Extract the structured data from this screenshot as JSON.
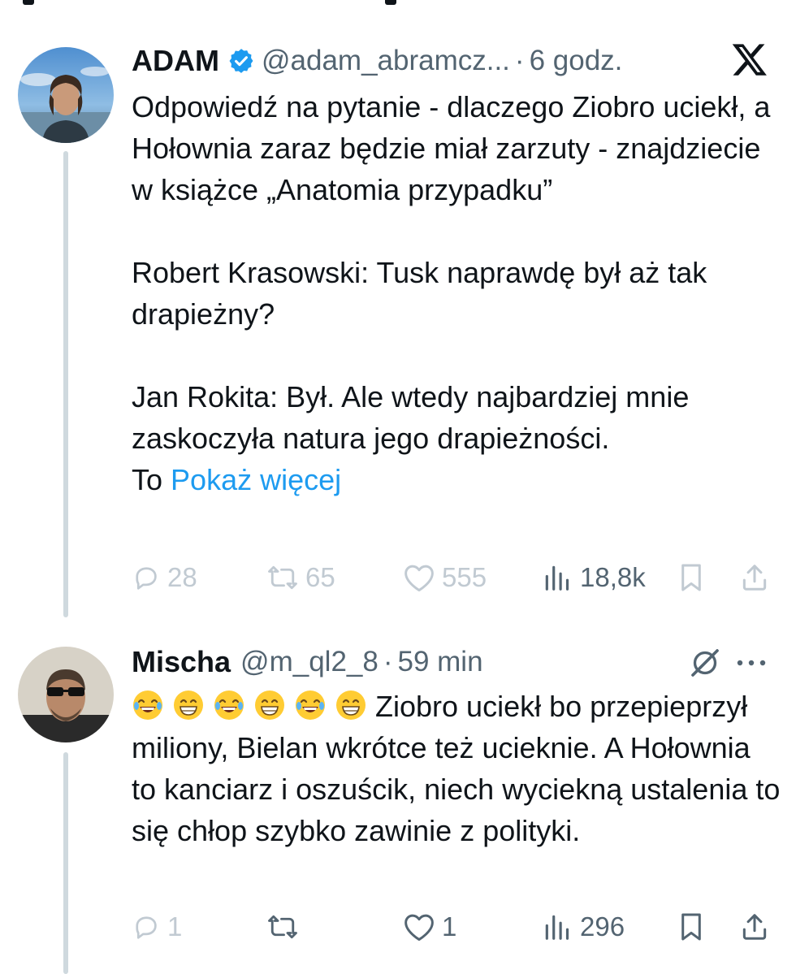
{
  "tweet_main": {
    "author_name": "ADAM",
    "handle": "@adam_abramcz...",
    "separator": "·",
    "time": "6 godz.",
    "paragraphs": [
      "Odpowiedź na pytanie -  dlaczego Ziobro uciekł, a Hołownia zaraz będzie miał zarzuty - znajdziecie w książce „Anatomia przypadku”",
      "Robert Krasowski: Tusk naprawdę był aż tak drapieżny?",
      "Jan Rokita: Był. Ale wtedy najbardziej mnie zaskoczyła natura jego drapieżności."
    ],
    "truncated_word": "To",
    "show_more": "Pokaż więcej",
    "stats": {
      "replies": "28",
      "reposts": "65",
      "likes": "555",
      "views": "18,8k"
    },
    "icons": [
      "verified-badge-icon",
      "x-logo-icon",
      "reply-icon",
      "repost-icon",
      "like-icon",
      "views-icon",
      "bookmark-icon",
      "share-icon"
    ]
  },
  "tweet_reply": {
    "author_name": "Mischa",
    "handle": "@m_ql2_8",
    "separator": "·",
    "time": "59 min",
    "emojis": [
      "😂",
      "😁",
      "😂",
      "😁",
      "😂",
      "😁"
    ],
    "text": "Ziobro uciekł bo przepieprzył miliony, Bielan wkrótce też ucieknie. A Hołownia to kanciarz i oszuścik, niech wyciekną ustalenia to się chłop szybko zawinie z polityki.",
    "stats": {
      "replies": "1",
      "reposts": "",
      "likes": "1",
      "views": "296"
    },
    "icons": [
      "grok-icon",
      "more-icon",
      "reply-icon",
      "repost-icon",
      "like-icon",
      "views-icon",
      "bookmark-icon",
      "share-icon"
    ]
  },
  "colors": {
    "text": "#0f1419",
    "secondary": "#536471",
    "faded": "#c1cad2",
    "link": "#1d9bf0",
    "verified": "#1d9bf0",
    "thread_line": "#cfd9de"
  }
}
